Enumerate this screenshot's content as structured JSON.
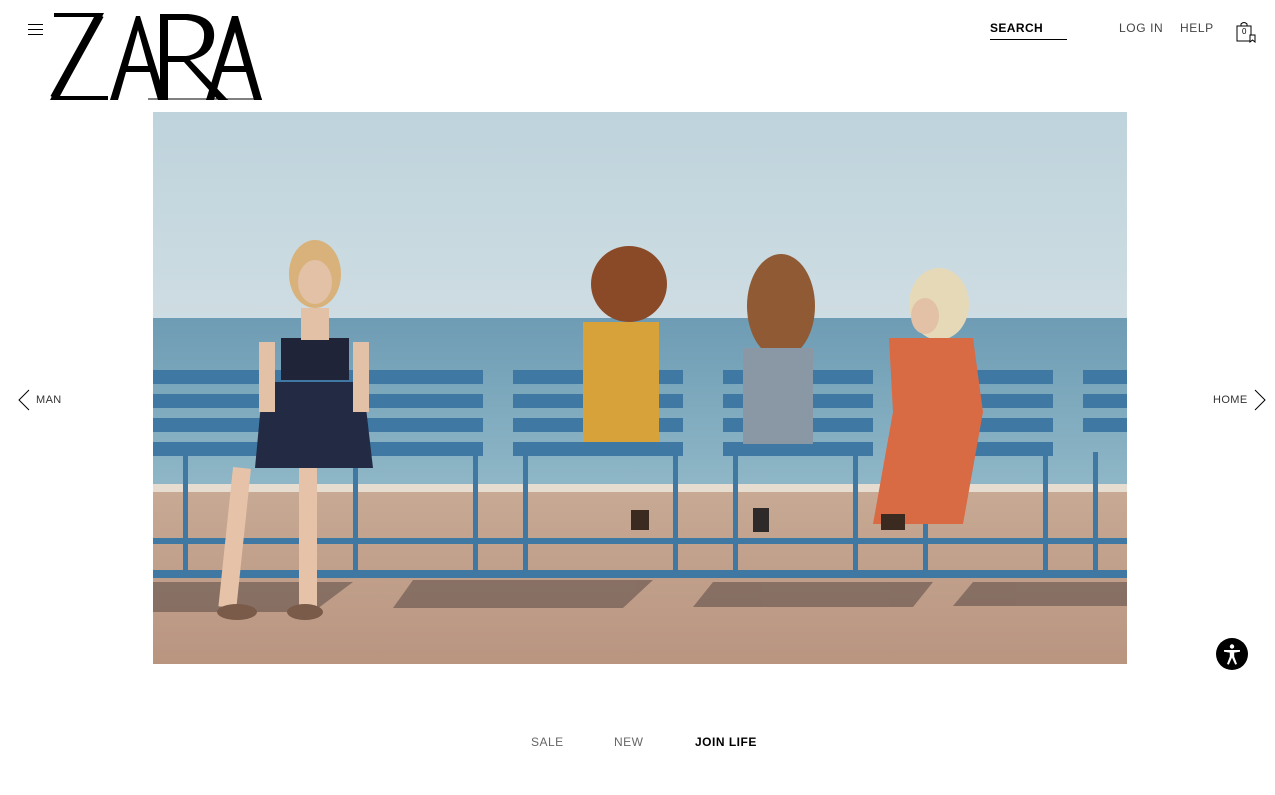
{
  "header": {
    "logo_text": "ZARA",
    "search_label": "SEARCH",
    "login_label": "LOG IN",
    "help_label": "HELP",
    "bag_count": "0"
  },
  "hero": {
    "prev_label": "MAN",
    "next_label": "HOME"
  },
  "bottom_nav": {
    "items": [
      "SALE",
      "NEW",
      "JOIN LIFE"
    ],
    "active": "JOIN LIFE"
  },
  "icons": {
    "menu": "menu-icon",
    "bag": "shopping-bag-icon",
    "prev": "chevron-left-icon",
    "next": "chevron-right-icon",
    "accessibility": "accessibility-icon"
  },
  "colors": {
    "background": "#ffffff",
    "text": "#000000",
    "accessibility_button": "#000000"
  }
}
